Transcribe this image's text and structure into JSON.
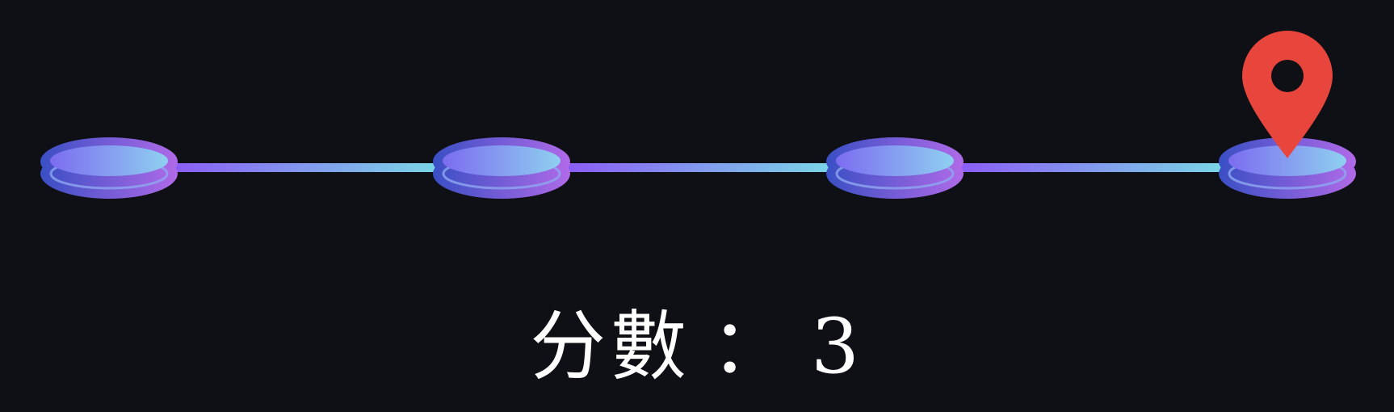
{
  "game": {
    "stone_count": 4,
    "current_stone_index": 3,
    "colors": {
      "background": "#0f1016",
      "stone_rim": "#3a4fc4",
      "stone_rim_alt": "#b06ae8",
      "stone_top_left": "#7c6cf0",
      "stone_top_right": "#8fd0f0",
      "bridge_left": "#8b5cf6",
      "bridge_right": "#7ad6e6",
      "marker": "#e8453c",
      "marker_hole": "#0f1016",
      "score_text": "#ffffff"
    },
    "icons": {
      "marker": "location-pin-icon",
      "stone": "stepping-stone-icon",
      "bridge": "bridge-connector"
    }
  },
  "score": {
    "label": "分數",
    "separator": "：",
    "value": "3"
  }
}
